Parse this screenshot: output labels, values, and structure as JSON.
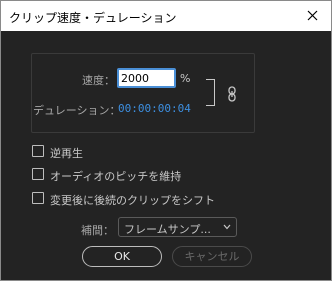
{
  "window": {
    "title": "クリップ速度・デュレーション",
    "close_icon": "close-icon"
  },
  "speed": {
    "label": "速度：",
    "value": "2000",
    "unit": "%"
  },
  "duration": {
    "label": "デュレーション：",
    "value": "00:00:00:04",
    "value_color": "#3d8fe0"
  },
  "link_icon": "chain-link-icon",
  "options": [
    {
      "label": "逆再生",
      "checked": false
    },
    {
      "label": "オーディオのピッチを維持",
      "checked": false
    },
    {
      "label": "変更後に後続のクリップをシフト",
      "checked": false
    }
  ],
  "interpolation": {
    "label": "補間：",
    "selected": "フレームサンプ..."
  },
  "buttons": {
    "ok": "OK",
    "cancel": "キャンセル"
  },
  "colors": {
    "background": "#232323",
    "input_focus_border": "#4a8fd6",
    "accent_blue": "#3d8fe0"
  }
}
